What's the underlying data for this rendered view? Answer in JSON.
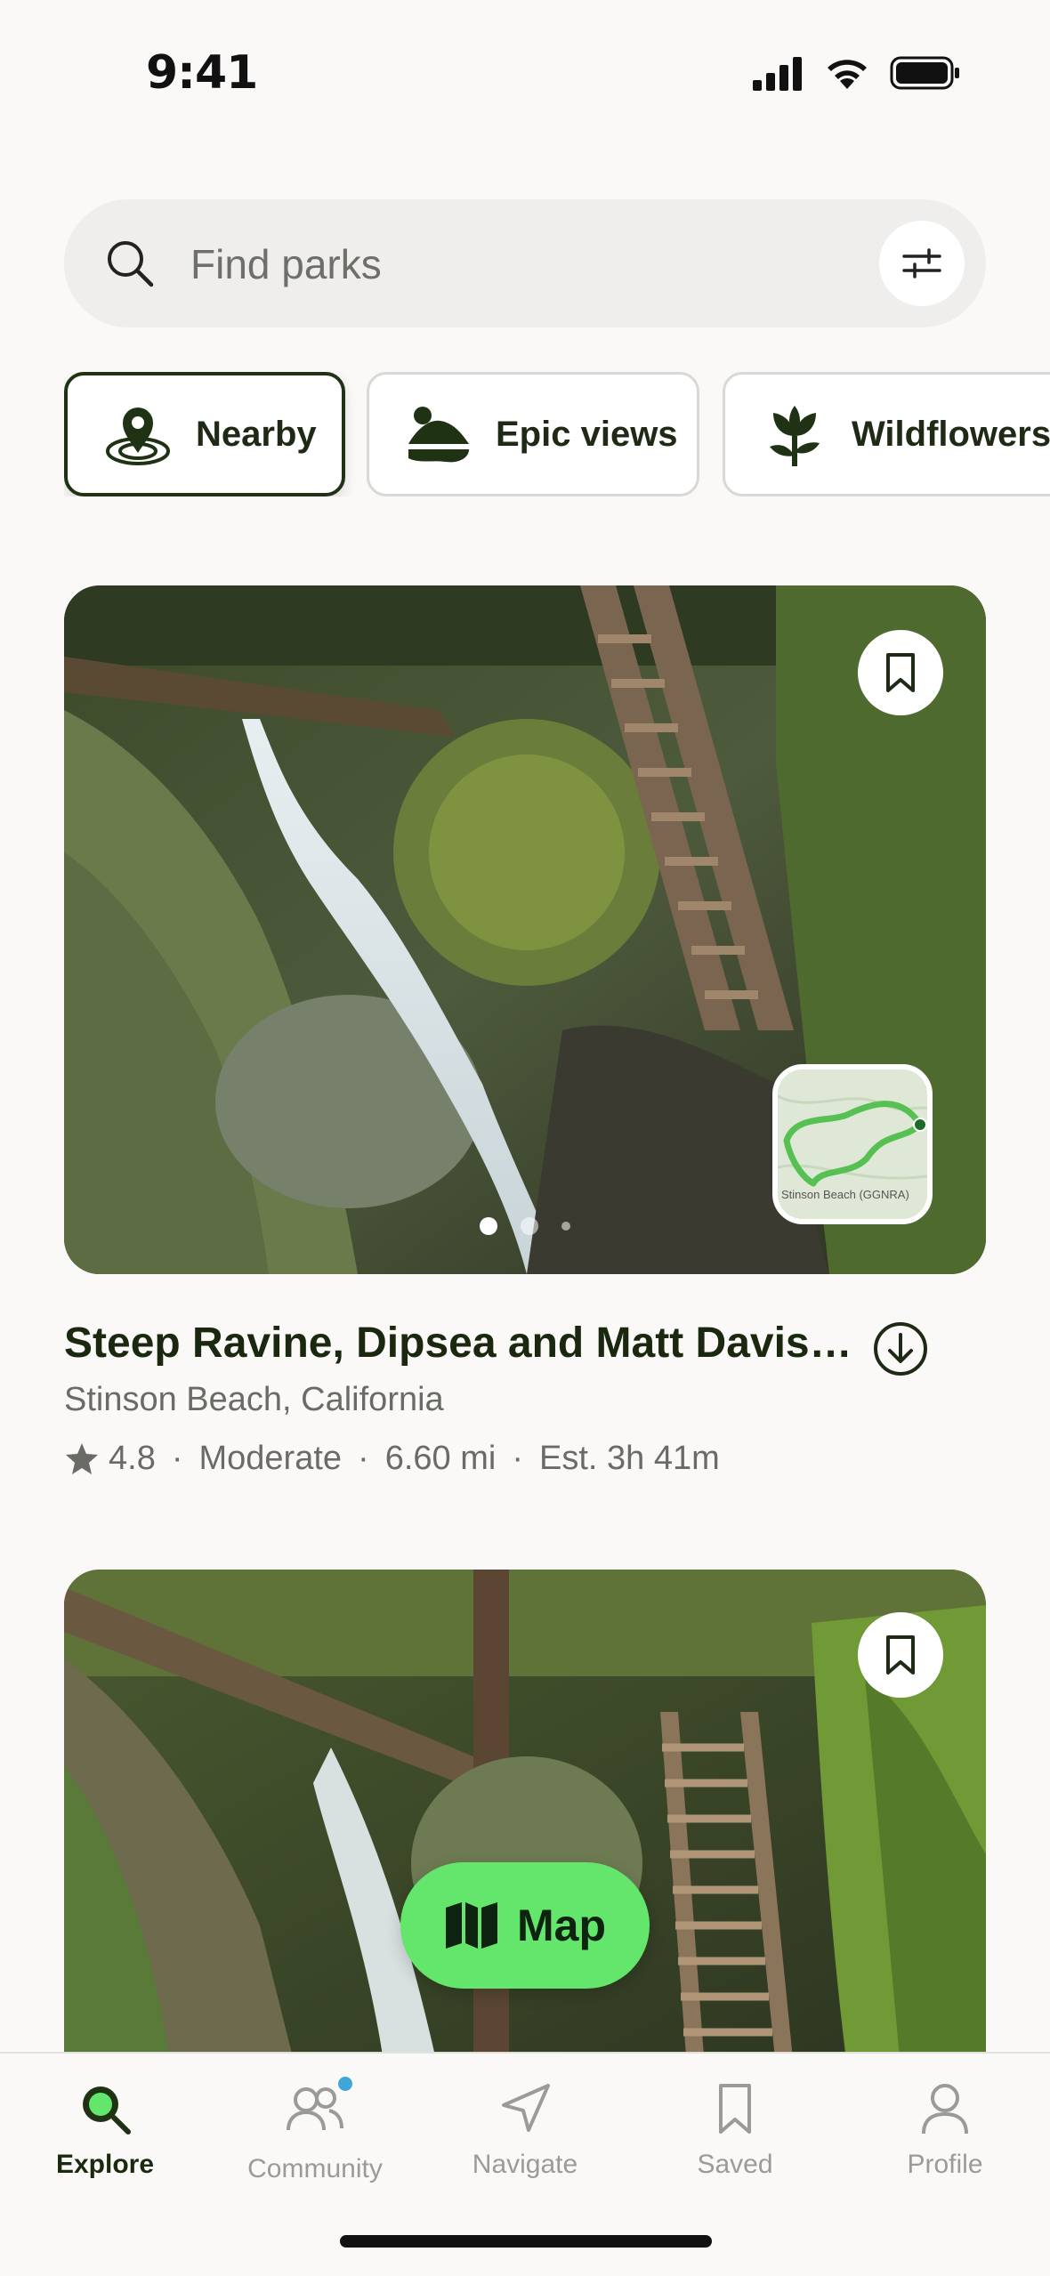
{
  "status_bar": {
    "time": "9:41"
  },
  "search": {
    "placeholder": "Find parks"
  },
  "chips": [
    {
      "label": "Nearby",
      "icon": "location-pin-icon",
      "active": true
    },
    {
      "label": "Epic views",
      "icon": "mountain-icon",
      "active": false
    },
    {
      "label": "Wildflowers",
      "icon": "flower-icon",
      "active": false
    }
  ],
  "trails": [
    {
      "title": "Steep Ravine, Dipsea and Matt Davis…",
      "location": "Stinson Beach, California",
      "rating": "4.8",
      "difficulty": "Moderate",
      "distance": "6.60 mi",
      "estimate": "Est. 3h 41m",
      "map_label": "Stinson Beach (GGNRA)",
      "photo_index": 1,
      "photo_count": 3
    }
  ],
  "map_button": {
    "label": "Map"
  },
  "tabbar": {
    "items": [
      {
        "label": "Explore",
        "icon": "search-icon",
        "active": true
      },
      {
        "label": "Community",
        "icon": "people-icon",
        "active": false
      },
      {
        "label": "Navigate",
        "icon": "navigate-arrow-icon",
        "active": false
      },
      {
        "label": "Saved",
        "icon": "bookmark-icon",
        "active": false
      },
      {
        "label": "Profile",
        "icon": "profile-icon",
        "active": false
      }
    ]
  },
  "colors": {
    "accent_green": "#63e66b",
    "dark_green": "#1f3314",
    "notification_blue": "#3fa6d6"
  }
}
